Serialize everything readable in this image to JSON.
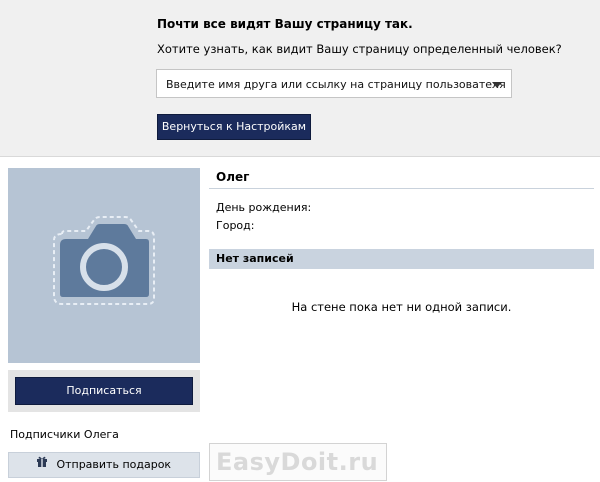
{
  "privacy_preview": {
    "title": "Почти все видят Вашу страницу так.",
    "question": "Хотите узнать, как видит Вашу страницу определенный человек?",
    "friend_select_placeholder": "Введите имя друга или ссылку на страницу пользователя",
    "back_button_label": "Вернуться к Настройкам"
  },
  "profile": {
    "name": "Олег",
    "birthday_label": "День рождения:",
    "city_label": "Город:",
    "subscribe_label": "Подписаться",
    "followers_label": "Подписчики Олега",
    "gift_label": "Отправить подарок"
  },
  "wall": {
    "header": "Нет записей",
    "empty_text": "На стене пока нет ни одной записи."
  },
  "watermark": "EasyDoit.ru",
  "colors": {
    "accent_button": "#1b2b5c",
    "avatar_bg": "#b6c4d4",
    "wall_header_bg": "#c9d3df",
    "top_panel_bg": "#f0f0f0"
  },
  "icons": {
    "avatar": "camera-icon",
    "dropdown": "chevron-down-icon",
    "gift": "gift-icon"
  }
}
